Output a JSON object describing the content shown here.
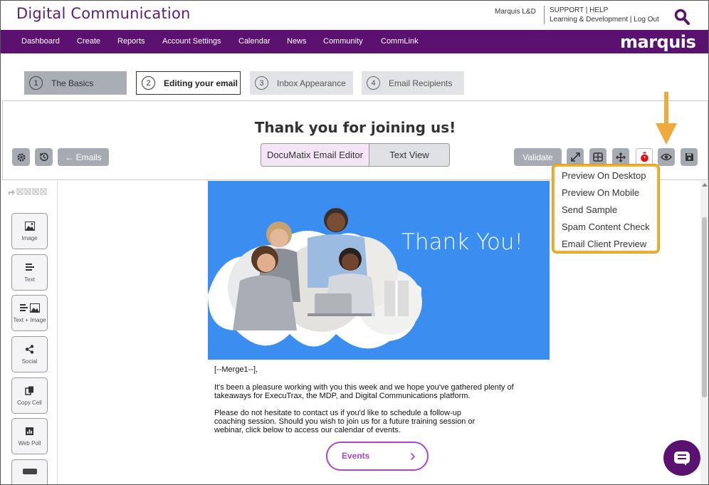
{
  "header": {
    "app_title": "Digital Communication",
    "org_name": "Marquis L&D",
    "links_top": {
      "support": "SUPPORT",
      "sep": " | ",
      "help": "HELP"
    },
    "links_bottom": {
      "learning": "Learning & Development",
      "sep": " | ",
      "logout": "Log Out"
    },
    "search_icon": "search-icon"
  },
  "navbar": {
    "items": [
      "Dashboard",
      "Create",
      "Reports",
      "Account Settings",
      "Calendar",
      "News",
      "Community",
      "CommLink"
    ],
    "logo": "marquis",
    "color": "#5b1170"
  },
  "steps": [
    {
      "num": "1",
      "label": "The Basics",
      "state": "done"
    },
    {
      "num": "2",
      "label": "Editing your email",
      "state": "active"
    },
    {
      "num": "3",
      "label": "Inbox Appearance",
      "state": "pending"
    },
    {
      "num": "4",
      "label": "Email Recipients",
      "state": "pending"
    }
  ],
  "editor": {
    "email_title": "Thank you for joining us!",
    "emails_button": "← Emails",
    "editor_toggle": "DocuMatix Email Editor",
    "text_view_toggle": "Text View",
    "validate_button": "Validate",
    "icons": [
      "gear-icon",
      "history-icon",
      "expand-icon",
      "grid-icon",
      "move-icon",
      "timer-icon",
      "eye-icon",
      "save-icon"
    ]
  },
  "preview_menu": {
    "items": [
      "Preview On Desktop",
      "Preview On Mobile",
      "Send Sample",
      "Spam Content Check",
      "Email Client Preview"
    ],
    "highlight_color": "#f0b030"
  },
  "palette": {
    "items": [
      {
        "label": "Image",
        "icon": "image-icon"
      },
      {
        "label": "Text",
        "icon": "text-icon"
      },
      {
        "label": "Text + Image",
        "icon": "text-image-icon"
      },
      {
        "label": "Social",
        "icon": "share-icon"
      },
      {
        "label": "Copy Cell",
        "icon": "copy-icon"
      },
      {
        "label": "Web Poll",
        "icon": "poll-icon"
      }
    ]
  },
  "email_body": {
    "hero_text": "Thank You!",
    "merge_tag": "[--Merge1--],",
    "para1_line1": "It's been a pleasure working with you this week and we hope you've gathered plenty of",
    "para1_line2": "takeaways for ExecuTrax, the MDP, and Digital Communications platform.",
    "para2_line1": "Please do not hesitate to contact us if you'd like to schedule a follow-up",
    "para2_line2": "coaching session. Should you wish to join us for a future training session or",
    "para2_line3": "webinar, click below to access our calendar of events.",
    "events_button": "Events",
    "hero_color": "#3a8ef0",
    "button_color": "#a64ac9"
  }
}
